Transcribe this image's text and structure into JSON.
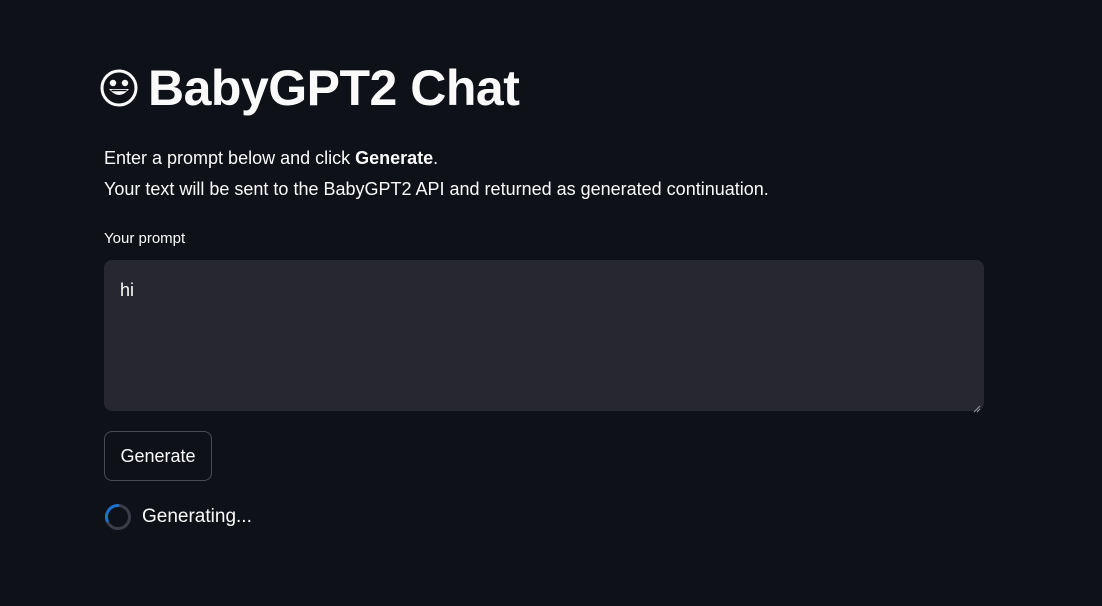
{
  "header": {
    "icon": "grinning-face-icon",
    "title": "BabyGPT2 Chat"
  },
  "intro": {
    "line1_prefix": "Enter a prompt below and click ",
    "line1_bold": "Generate",
    "line1_suffix": ".",
    "line2": "Your text will be sent to the BabyGPT2 API and returned as generated continuation."
  },
  "prompt": {
    "label": "Your prompt",
    "value": "hi"
  },
  "actions": {
    "generate_label": "Generate"
  },
  "status": {
    "icon": "spinner-icon",
    "text": "Generating..."
  },
  "colors": {
    "background": "#0e1117",
    "input_background": "#262730",
    "text": "#fafafa",
    "spinner_accent": "#1f6fcf"
  }
}
